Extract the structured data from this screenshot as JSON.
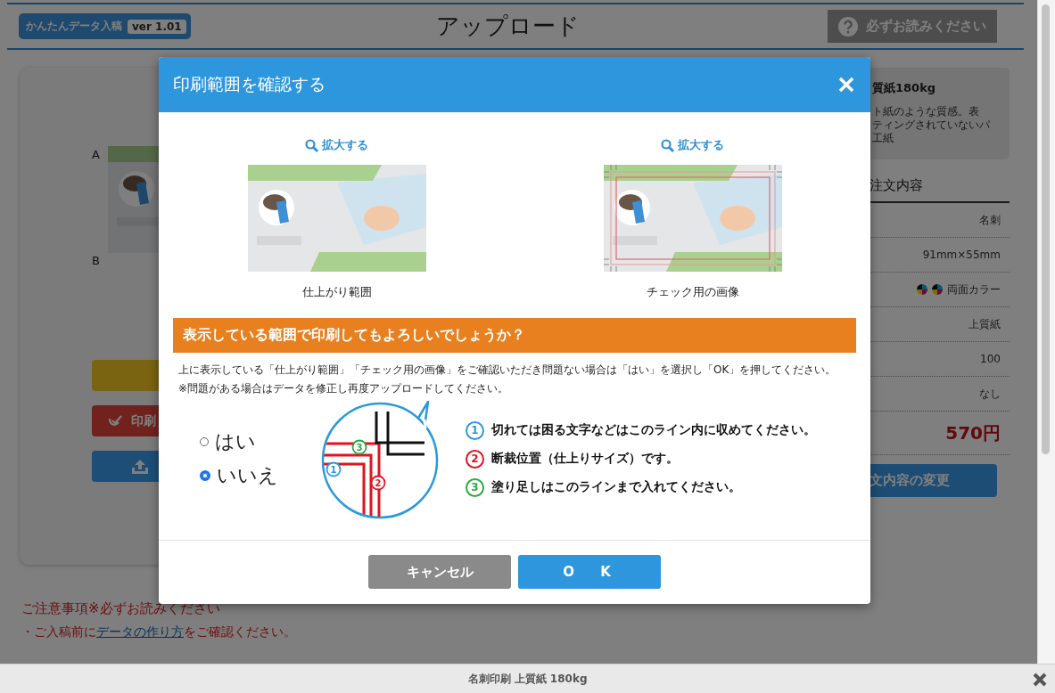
{
  "header": {
    "logo": "かんたんデータ入稿",
    "version": "ver 1.01",
    "title": "アップロード",
    "help_button": "必ずお読みください"
  },
  "upload_panel": {
    "label_top": "A",
    "label_bottom": "B",
    "buttons": [
      {
        "kind": "plain"
      },
      {
        "kind": "check",
        "label": "印刷"
      },
      {
        "kind": "upload"
      }
    ]
  },
  "order_panel": {
    "paper_title": "質紙180kg",
    "paper_description": [
      "ト紙のような質感。表",
      "ティングされていないパ",
      "工紙"
    ],
    "heading": "注文内容",
    "rows": [
      {
        "kind": "text",
        "value": "名刺"
      },
      {
        "kind": "text",
        "value": "91mm×55mm"
      },
      {
        "kind": "color",
        "value": "両面カラー"
      },
      {
        "kind": "text",
        "value": "上質紙"
      },
      {
        "kind": "text",
        "value": "100"
      },
      {
        "kind": "text",
        "value": "なし"
      },
      {
        "kind": "price",
        "value": "570円"
      }
    ],
    "change_button": "文内容の変更"
  },
  "notes": {
    "title": "ご注意事項※必ずお読みください",
    "items": [
      {
        "before": "・ご入稿前に",
        "link": "データの作り方",
        "after": "をご確認ください。"
      }
    ]
  },
  "footer": {
    "title": "名刺印刷 上質紙 180kg"
  },
  "dialog": {
    "title": "印刷範囲を確認する",
    "previews": [
      {
        "kind": "finished",
        "zoom_link": "拡大する",
        "caption": "仕上がり範囲"
      },
      {
        "kind": "check",
        "zoom_link": "拡大する",
        "caption": "チェック用の画像"
      }
    ],
    "question": "表示している範囲で印刷してもよろしいでしょうか？",
    "instructions": [
      "上に表示している「仕上がり範囲」「チェック用の画像」をご確認いただき問題ない場合は「はい」を選択し「OK」を押してください。",
      "※問題がある場合はデータを修正し再度アップロードしてください。"
    ],
    "options": [
      {
        "label": "はい",
        "selected": false
      },
      {
        "label": "いいえ",
        "selected": true
      }
    ],
    "diagram_markers": [
      {
        "number": "3",
        "color": "#2ca640"
      },
      {
        "number": "1",
        "color": "#2a9ad8"
      },
      {
        "number": "2",
        "color": "#e0141e"
      }
    ],
    "legend": [
      {
        "number": "1",
        "color": "#2a9ad8",
        "text": "切れては困る文字などはこのライン内に収めてください。"
      },
      {
        "number": "2",
        "color": "#e0141e",
        "text": "断裁位置（仕上りサイズ）です。"
      },
      {
        "number": "3",
        "color": "#2ca640",
        "text": "塗り足しはこのラインまで入れてください。"
      }
    ],
    "buttons": [
      {
        "kind": "cancel",
        "label": "キャンセル"
      },
      {
        "kind": "ok",
        "label": "O K"
      }
    ]
  }
}
